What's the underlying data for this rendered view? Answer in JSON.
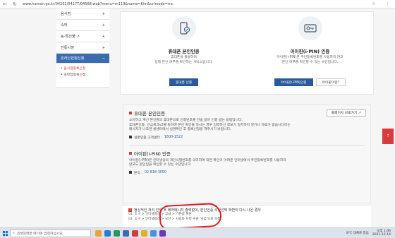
{
  "browser": {
    "url": "www.haman.go.kr/04202/04177/04568.web?menu=m119&name=Kim&urlmode=mc",
    "nav_back": "←",
    "nav_refresh": "↻",
    "tools": [
      "☆",
      "⋮"
    ]
  },
  "sidebar": {
    "items": [
      {
        "label": "음식점",
        "marker": "+"
      },
      {
        "label": "숙박",
        "marker": "+"
      },
      {
        "label": "농·특산물 ↗",
        "marker": "+"
      },
      {
        "label": "전통시장",
        "marker": "+"
      },
      {
        "label": "온라인민원신청",
        "marker": "−"
      }
    ],
    "subitems": [
      {
        "label": "• 음식점등록신청",
        "selected": true
      },
      {
        "label": "• 숙박업등록신청",
        "selected": false
      }
    ]
  },
  "cards": [
    {
      "title": "휴대폰 본인인증",
      "desc_lines": [
        "휴대폰을 활용하여",
        "실제 본인 여부를 확인하는 서비스입니다."
      ],
      "buttons": [
        {
          "label": "휴대폰 인증",
          "style": "blue"
        }
      ]
    },
    {
      "title": "아이핀(i-PIN) 인증",
      "desc_lines": [
        "아이핀(i-PIN)은 주민등록번호를 사용하지 않고",
        "본인 여부를 확인할 수 있는 수단입니다."
      ],
      "buttons": [
        {
          "label": "아이핀(i-PIN)인증",
          "style": "blue"
        },
        {
          "label": "아이핀이란?",
          "style": "plain"
        }
      ]
    }
  ],
  "info": {
    "phone_title": "휴대폰 본인인증",
    "phone_button": "홈페이지 바로가기 ↗",
    "phone_desc": [
      "소지하고 계신 본인명의 휴대폰으로 인증번호를 전송 받아 인증 받는 방법입니다.",
      "휴대폰인증, 안심체크v2를 통하여 본인 확인을 하시는 경우 입력하신 정보가 일치하지 않거나 자료가 없습니다라는",
      "메시지가 나오면 콜센터에서 실명확인 후 등록신청을 해주시기 바랍니다."
    ],
    "phone_contact_label": "실명인증 고객센터 :",
    "phone_contact_number": "1600-1522",
    "ipin_title": "아이핀(i-PIN) 인증",
    "ipin_desc": [
      "아이핀(i-PIN)은 인터넷상의 개인식별번호를 의미하며 대면 확인이 어려운 인터넷에서 주민등록번호를 사용하지",
      "않고도 본인임을 확인할 수 있는 수단입니다."
    ],
    "ipin_contact_label": "문의 :",
    "ipin_contact_number": "02-818-3050"
  },
  "notice": {
    "head": "정상적인 처리 진행 후 에러메시지 출력없이, 본인인증 수단선택 화면이 다시 나온 경우",
    "lines": [
      "01. 도구 > 인터넷옵션 > 고급 > 기본값 복원",
      "02. 도구 > 인터넷옵션 > 보안 > 사용자 지정 수준 '낮음'으로 조정"
    ]
  },
  "side_button": "↑",
  "taskbar": {
    "search_placeholder": "검색하려면 여기에 입력하십시오.",
    "weather": "8°C 대체로 맑음",
    "time": "오후 1:46",
    "date": "2021-12-14",
    "app_colors": [
      "#f0a030",
      "#2a7ad8",
      "#1e9e5a",
      "#3a6cb0",
      "#d23b3b",
      "#e0b020",
      "#4a90e2",
      "#6a3ab0"
    ]
  },
  "colors": {
    "accent": "#3a6cb0",
    "button_blue": "#2a5a9e",
    "highlight_red": "#d23b3b",
    "annotation": "#e02020"
  }
}
